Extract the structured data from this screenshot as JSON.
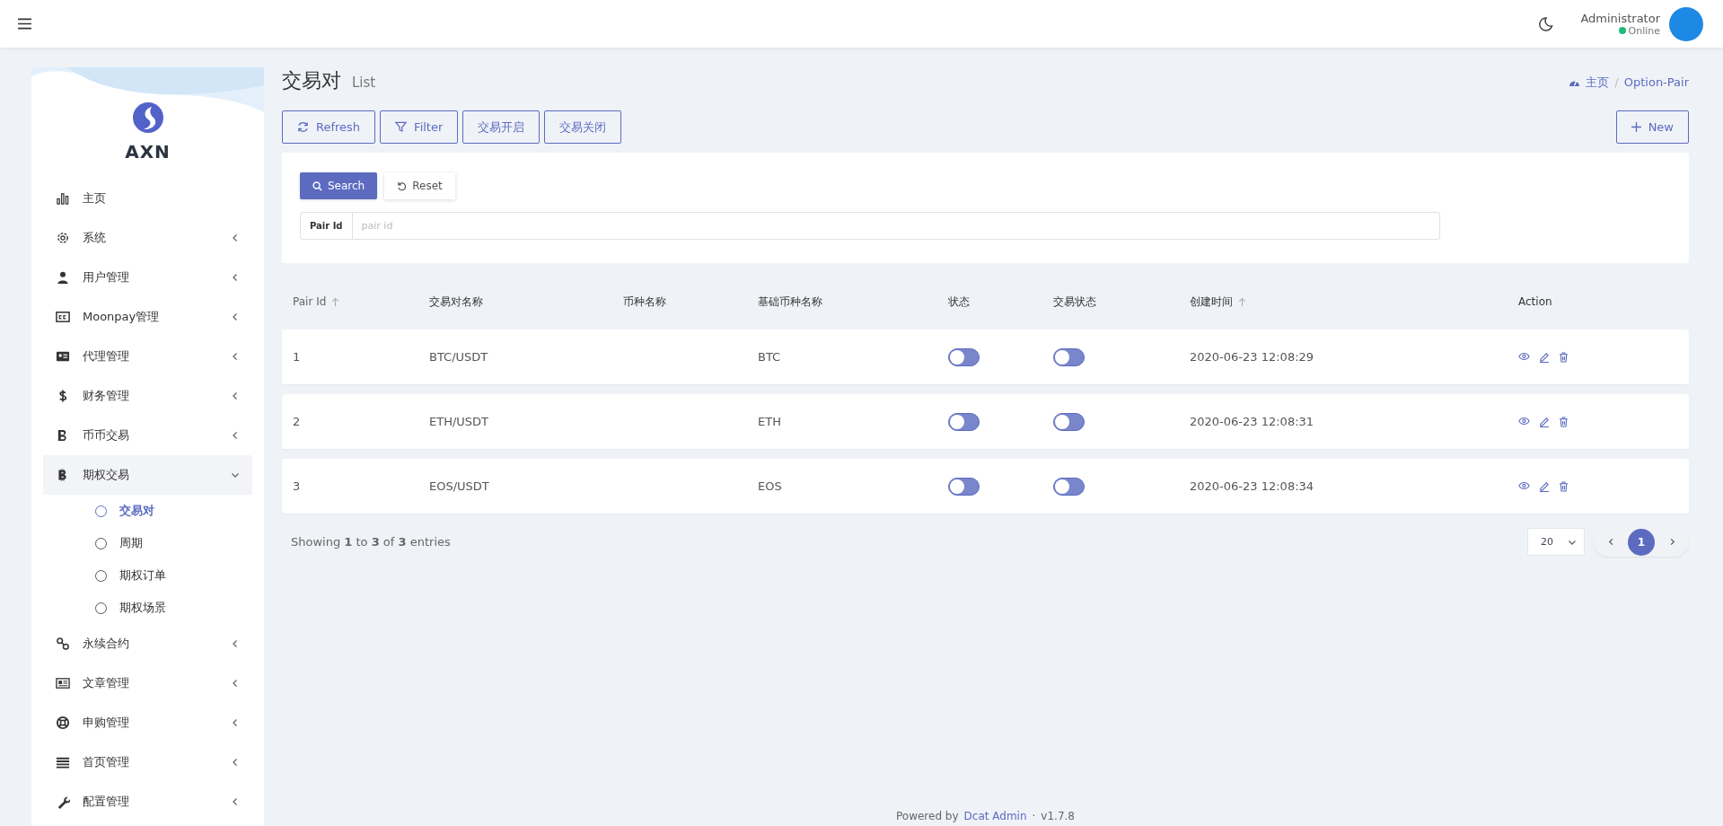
{
  "header": {
    "user": {
      "name": "Administrator",
      "status": "Online"
    }
  },
  "sidebar": {
    "brand": "AXN",
    "items": [
      {
        "label": "主页",
        "has_children": false,
        "expanded": false,
        "selected": false
      },
      {
        "label": "系统",
        "has_children": true,
        "expanded": false,
        "selected": false
      },
      {
        "label": "用户管理",
        "has_children": true,
        "expanded": false,
        "selected": false
      },
      {
        "label": "Moonpay管理",
        "has_children": true,
        "expanded": false,
        "selected": false
      },
      {
        "label": "代理管理",
        "has_children": true,
        "expanded": false,
        "selected": false
      },
      {
        "label": "财务管理",
        "has_children": true,
        "expanded": false,
        "selected": false
      },
      {
        "label": "币币交易",
        "has_children": true,
        "expanded": false,
        "selected": false
      },
      {
        "label": "期权交易",
        "has_children": true,
        "expanded": true,
        "selected": false,
        "children": [
          {
            "label": "交易对",
            "selected": true
          },
          {
            "label": "周期",
            "selected": false
          },
          {
            "label": "期权订单",
            "selected": false
          },
          {
            "label": "期权场景",
            "selected": false
          }
        ]
      },
      {
        "label": "永续合约",
        "has_children": true,
        "expanded": false,
        "selected": false
      },
      {
        "label": "文章管理",
        "has_children": true,
        "expanded": false,
        "selected": false
      },
      {
        "label": "申购管理",
        "has_children": true,
        "expanded": false,
        "selected": false
      },
      {
        "label": "首页管理",
        "has_children": true,
        "expanded": false,
        "selected": false
      },
      {
        "label": "配置管理",
        "has_children": true,
        "expanded": false,
        "selected": false
      }
    ]
  },
  "page": {
    "title": "交易对",
    "subtitle": "List",
    "breadcrumb": [
      "主页",
      "Option-Pair"
    ],
    "breadcrumb_separator": "/"
  },
  "toolbar": {
    "buttons": [
      {
        "label": "Refresh",
        "kind": "refresh"
      },
      {
        "label": "Filter",
        "kind": "filter"
      },
      {
        "label": "交易开启",
        "kind": "text"
      },
      {
        "label": "交易关闭",
        "kind": "text"
      }
    ],
    "new_button": "New"
  },
  "filter": {
    "search": "Search",
    "reset": "Reset",
    "field_label": "Pair Id",
    "placeholder": "pair id"
  },
  "table": {
    "columns": [
      {
        "label": "Pair Id",
        "sortable": true
      },
      {
        "label": "交易对名称",
        "sortable": false
      },
      {
        "label": "币种名称",
        "sortable": false
      },
      {
        "label": "基础币种名称",
        "sortable": false
      },
      {
        "label": "状态",
        "sortable": false
      },
      {
        "label": "交易状态",
        "sortable": false
      },
      {
        "label": "创建时间",
        "sortable": true
      },
      {
        "label": "Action",
        "sortable": false
      }
    ],
    "rows": [
      {
        "id": "1",
        "pair": "BTC/USDT",
        "base": "BTC",
        "status_on": false,
        "trade_on": false,
        "created": "2020-06-23 12:08:29"
      },
      {
        "id": "2",
        "pair": "ETH/USDT",
        "base": "ETH",
        "status_on": false,
        "trade_on": false,
        "created": "2020-06-23 12:08:31"
      },
      {
        "id": "3",
        "pair": "EOS/USDT",
        "base": "EOS",
        "status_on": false,
        "trade_on": false,
        "created": "2020-06-23 12:08:34"
      }
    ]
  },
  "pagination": {
    "summary": "Showing **1** to **3** of **3** entries",
    "per_page": "20",
    "pages": [
      {
        "label": "1",
        "selected": true
      }
    ]
  },
  "footer": {
    "prefix": "Powered by",
    "link": "Dcat Admin",
    "separator": "·",
    "version": "v1.7.8"
  }
}
